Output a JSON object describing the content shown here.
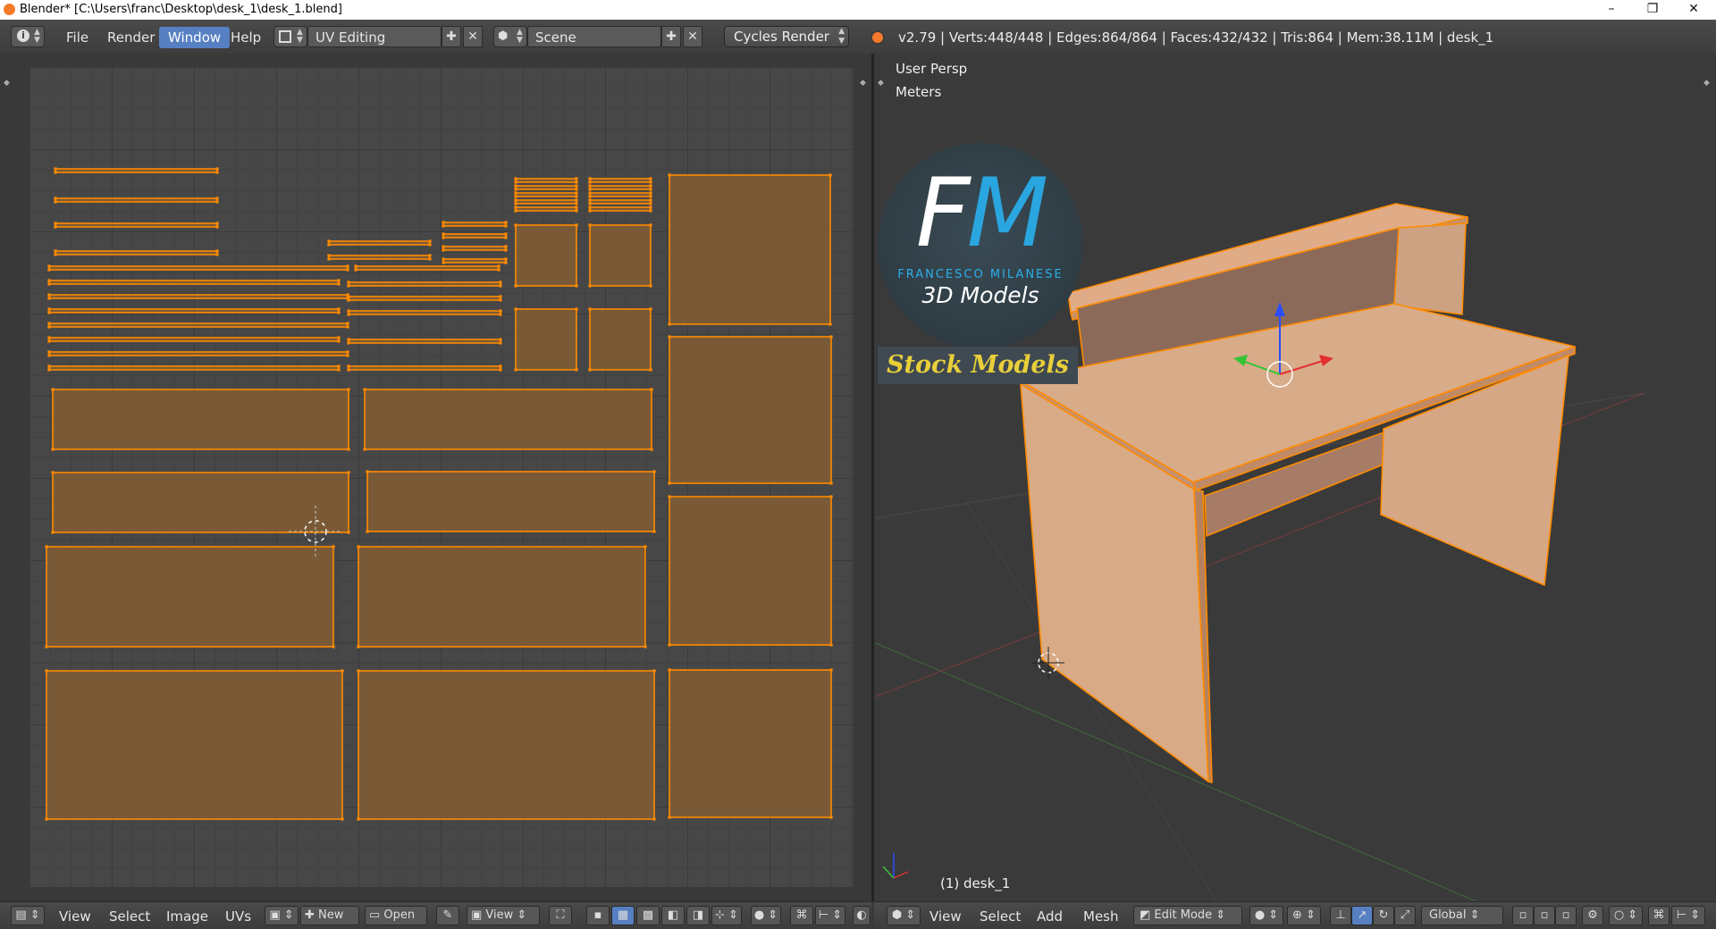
{
  "window": {
    "title": "Blender* [C:\\Users\\franc\\Desktop\\desk_1\\desk_1.blend]",
    "minimize_glyph": "–",
    "restore_glyph": "❐",
    "close_glyph": "✕"
  },
  "info_header": {
    "menus": [
      "File",
      "Render",
      "Window",
      "Help"
    ],
    "active_menu": "Window",
    "screen_layout": "UV Editing",
    "scene": "Scene",
    "render_engine": "Cycles Render",
    "stats": "v2.79 | Verts:448/448 | Edges:864/864 | Faces:432/432 | Tris:864 | Mem:38.11M | desk_1",
    "accent_color": "#5680c2"
  },
  "uv_editor": {
    "footer": {
      "menus": [
        "View",
        "Select",
        "Image",
        "UVs"
      ],
      "new_label": "New",
      "open_label": "Open",
      "view_label": "View"
    },
    "island_fill": "#7a5a36",
    "island_edge": "#ff8a00"
  },
  "viewport_3d": {
    "view_label": "User Persp",
    "units_label": "Meters",
    "object_label": "(1) desk_1",
    "footer": {
      "menus": [
        "View",
        "Select",
        "Add",
        "Mesh"
      ],
      "mode": "Edit Mode",
      "orientation": "Global"
    },
    "selection_color": "#ff8a00"
  },
  "logo": {
    "letters_f": "F",
    "letters_m": "M",
    "brand_name": "FRANCESCO MILANESE",
    "tagline": "3D Models",
    "banner": "Stock Models"
  }
}
